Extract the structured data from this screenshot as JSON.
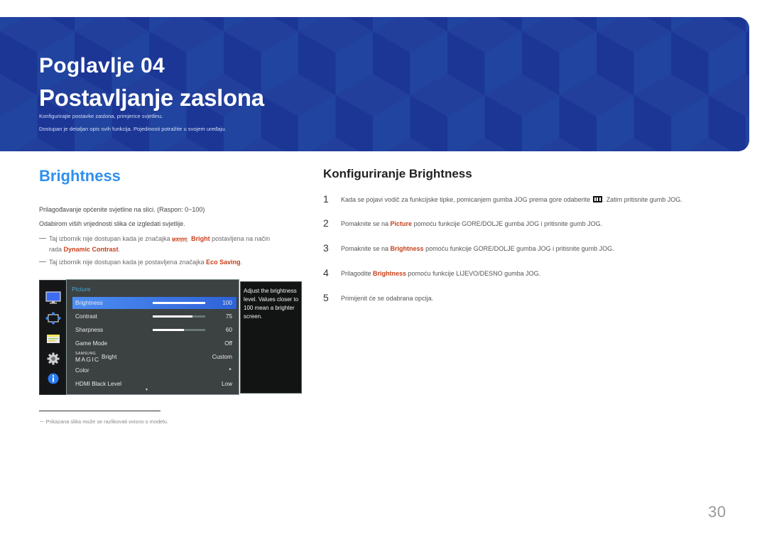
{
  "banner": {
    "chapter": "Poglavlje  04",
    "title": "Postavljanje zaslona",
    "subtitle_1": "Konfigurirajte postavke zaslona, primjerice svjetlinu.",
    "subtitle_2": "Dostupan je detaljan opis svih funkcija. Pojedinosti potražite u svojem uređaju.",
    "color": "#1f3a9a"
  },
  "left": {
    "heading": "Brightness",
    "para_1": "Prilagođavanje općenite svjetline na slici. (Raspon: 0~100)",
    "para_2": "Odabirom viših vrijednosti slika će izgledati svjetlije.",
    "note_1": {
      "before": "Taj izbornik nije dostupan kada je značajka ",
      "magic_small": "SAMSUNG",
      "magic_big": "MAGIC",
      "feature": "Bright",
      "middle": " postavljena na način",
      "line2_before": "rada ",
      "mode": "Dynamic Contrast",
      "after": "."
    },
    "note_2": {
      "before": "Taj izbornik nije dostupan kada je postavljena značajka ",
      "feature": "Eco Saving",
      "after": "."
    }
  },
  "osd": {
    "sidebar_icons": [
      "picture-icon",
      "onscreen-display-icon",
      "system-icon",
      "settings-gear-icon",
      "information-icon"
    ],
    "menu_title": "Picture",
    "rows": [
      {
        "label": "Brightness",
        "value": "100",
        "bar_percent": 100,
        "selected": true
      },
      {
        "label": "Contrast",
        "value": "75",
        "bar_percent": 75
      },
      {
        "label": "Sharpness",
        "value": "60",
        "bar_percent": 60
      },
      {
        "label": "Game Mode",
        "value": "Off"
      },
      {
        "label_small": "SAMSUNG",
        "label_big": "MAGIC",
        "label": "Bright",
        "value": "Custom"
      },
      {
        "label": "Color",
        "value": "►"
      },
      {
        "label": "HDMI Black Level",
        "value": "Low"
      }
    ],
    "scroll_indicator": "▼",
    "help_text": "Adjust the brightness level. Values closer to 100 mean a brighter screen."
  },
  "footnote": "－  Prikazana slika može se razlikovati ovisno o modelu.",
  "right": {
    "heading": "Konfiguriranje Brightness",
    "steps": [
      {
        "num": "1",
        "before": "Kada se pojavi vodič za funkcijske tipke, pomicanjem gumba JOG prema gore odaberite ",
        "icon": "menu-icon",
        "after": ". Zatim pritisnite gumb JOG."
      },
      {
        "num": "2",
        "before": "Pomaknite se na ",
        "hl": "Picture",
        "after": " pomoću funkcije GORE/DOLJE gumba JOG i pritisnite gumb JOG."
      },
      {
        "num": "3",
        "before": "Pomaknite se na ",
        "hl": "Brightness",
        "after": " pomoću funkcije GORE/DOLJE gumba JOG i pritisnite gumb JOG."
      },
      {
        "num": "4",
        "before": "Prilagodite ",
        "hl": "Brightness",
        "after": " pomoću funkcije LIJEVO/DESNO gumba JOG."
      },
      {
        "num": "5",
        "before": "Primijenit će se odabrana opcija."
      }
    ]
  },
  "page_number": "30"
}
